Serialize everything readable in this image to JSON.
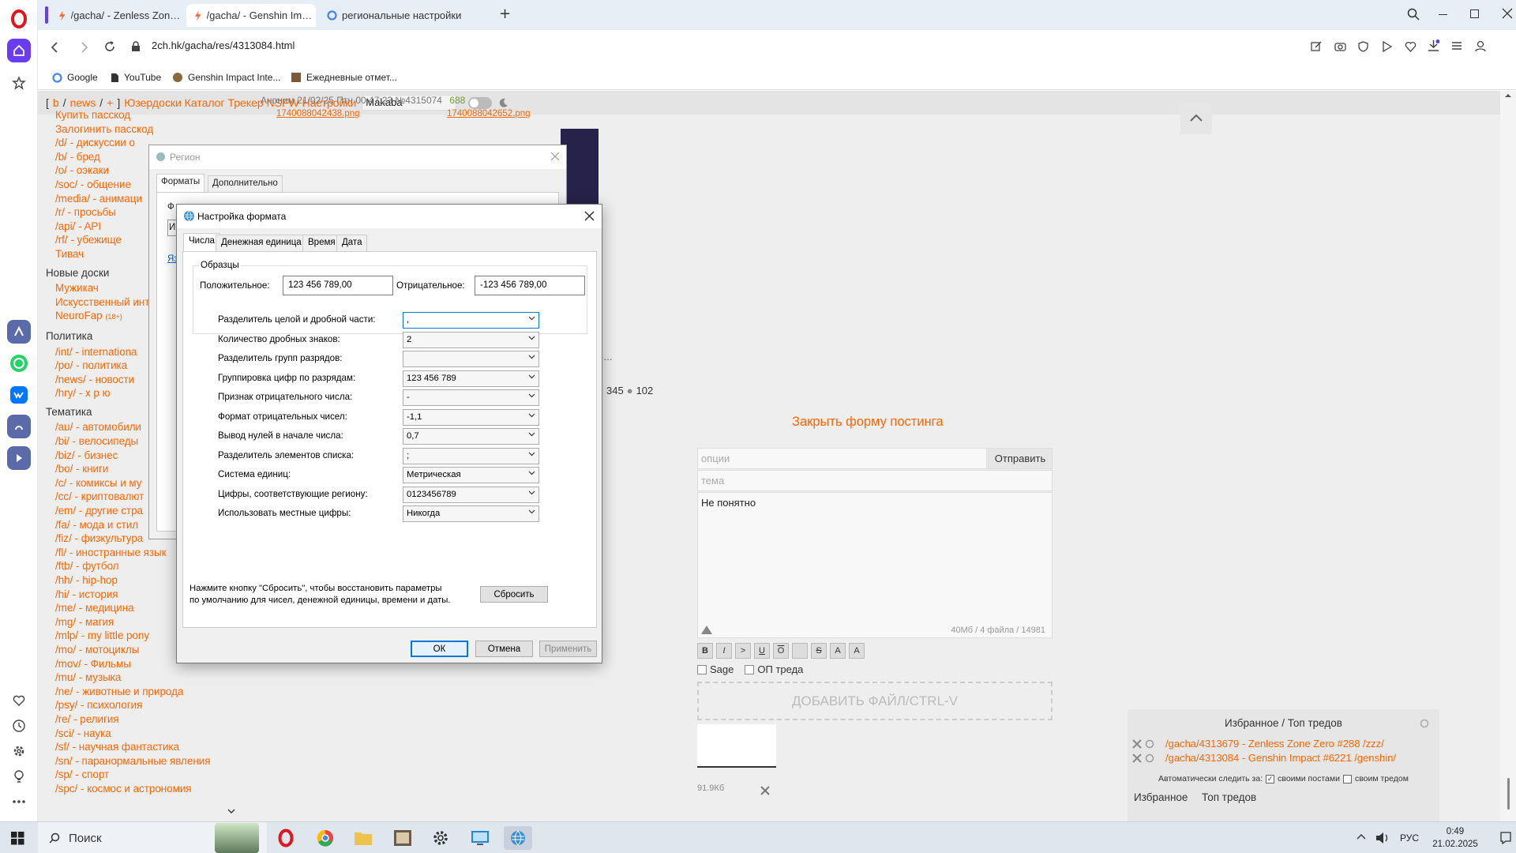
{
  "browser": {
    "tabs": [
      {
        "title": "/gacha/ - Zenless Zone Ze",
        "active": false
      },
      {
        "title": "/gacha/ - Genshin Impact",
        "active": true
      },
      {
        "title": "региональные настройки",
        "active": false
      }
    ],
    "new_tab": "+",
    "url": "2ch.hk/gacha/res/4313084.html",
    "bookmarks": [
      "Google",
      "YouTube",
      "Genshin Impact Inte...",
      "Ежедневные отмет..."
    ]
  },
  "site": {
    "nav": {
      "b": "b",
      "news": "news",
      "plus": "+",
      "rest": "Юзердоски Каталог Трекер NSFW Настройки",
      "style": "Makaba"
    },
    "boards_top": [
      "Купить пасскод",
      "Залогинить пасскод",
      "/d/ - дискуссии о",
      "/b/ - бред",
      "/o/ - оэкаки",
      "/soc/ - общение",
      "/media/ - анимаци",
      "/r/ - просьбы",
      "/api/ - API",
      "/rf/ - убежище",
      "Тивач"
    ],
    "new_boards_title": "Новые доски",
    "new_boards": [
      "Мужикач",
      "Искусственный инт",
      "NeuroFap"
    ],
    "neurofap_badge": "(18+)",
    "politics_title": "Политика",
    "politics": [
      "/int/ - internationa",
      "/po/ - политика",
      "/news/ - новости",
      "/hry/ - х р ю"
    ],
    "thematic_title": "Тематика",
    "thematic": [
      "/au/ - автомобили",
      "/bi/ - велосипеды",
      "/biz/ - бизнес",
      "/bo/ - книги",
      "/c/ - комиксы и му",
      "/cc/ - криптовалют",
      "/em/ - другие стра",
      "/fa/ - мода и стил",
      "/fiz/ - физкультура",
      "/fl/ - иностранные язык",
      "/ftb/ - футбол",
      "/hh/ - hip-hop",
      "/hi/ - история",
      "/me/ - медицина",
      "/mg/ - магия",
      "/mlp/ - my little pony",
      "/mo/ - мотоциклы",
      "/mov/ - Фильмы",
      "/mu/ - музыка",
      "/ne/ - животные и природа",
      "/psy/ - психология",
      "/re/ - религия",
      "/sci/ - наука",
      "/sf/ - научная фантастика",
      "/sn/ - паранормальные явления",
      "/sp/ - спорт",
      "/spc/ - космос и астрономия"
    ],
    "post_header": "Аноним 21/02/25 Птн 00:47:23 №4315074",
    "post_reply_count": "688",
    "file1": "1740088042438.png",
    "file2": "1740088042652.png",
    "post_ellipsis": "…",
    "stats": "345",
    "stats2": "102",
    "close_form": "Закрыть форму постинга",
    "options_placeholder": "опции",
    "send_button": "Отправить",
    "subject_placeholder": "тема",
    "comment": "Не понятно",
    "limits": "40Мб / 4 файла / 14981",
    "fmt_buttons": [
      "B",
      "I",
      ">",
      "U",
      "O",
      "",
      "S",
      "A",
      "A"
    ],
    "sage": "Sage",
    "op": "ОП треда",
    "add_file": "ДОБАВИТЬ ФАЙЛ/CTRL-V",
    "thumb_size": "91.9Кб",
    "favs_title": "Избранное / Топ тредов",
    "fav_threads": [
      "/gacha/4313679 - Zenless Zone Zero #288 /zzz/",
      "/gacha/4313084 - Genshin Impact #6221 /genshin/"
    ],
    "auto_watch": "Автоматически следить за:",
    "own_posts": "своими постами",
    "own_thread": "своим тредом",
    "fav_tabs": [
      "Избранное",
      "Топ тредов"
    ]
  },
  "region_dialog": {
    "title": "Регион",
    "tabs": [
      "Форматы",
      "Дополнительно"
    ],
    "frag_f": "Ф",
    "frag_i": "И",
    "frag_ya": "Яз"
  },
  "format_dialog": {
    "title": "Настройка формата",
    "tabs": [
      "Числа",
      "Денежная единица",
      "Время",
      "Дата"
    ],
    "samples_title": "Образцы",
    "positive_label": "Положительное:",
    "positive_value": "123 456 789,00",
    "negative_label": "Отрицательное:",
    "negative_value": "-123 456 789,00",
    "rows": [
      {
        "label": "Разделитель целой и дробной части:",
        "value": ","
      },
      {
        "label": "Количество дробных знаков:",
        "value": "2"
      },
      {
        "label": "Разделитель групп разрядов:",
        "value": ""
      },
      {
        "label": "Группировка цифр по разрядам:",
        "value": "123 456 789"
      },
      {
        "label": "Признак отрицательного числа:",
        "value": "-"
      },
      {
        "label": "Формат отрицательных чисел:",
        "value": "-1,1"
      },
      {
        "label": "Вывод нулей в начале числа:",
        "value": "0,7"
      },
      {
        "label": "Разделитель элементов списка:",
        "value": ";"
      },
      {
        "label": "Система единиц:",
        "value": "Метрическая"
      },
      {
        "label": "Цифры, соответствующие региону:",
        "value": "0123456789"
      },
      {
        "label": "Использовать местные цифры:",
        "value": "Никогда"
      }
    ],
    "reset_note_1": "Нажмите кнопку \"Сбросить\", чтобы восстановить параметры",
    "reset_note_2": "по умолчанию для чисел, денежной единицы, времени и даты.",
    "reset_button": "Сбросить",
    "ok_button": "ОК",
    "cancel_button": "Отмена",
    "apply_button": "Применить"
  },
  "taskbar": {
    "search_label": "Поиск",
    "lang": "РУС",
    "time": "0:49",
    "date": "21.02.2025"
  },
  "colors": {
    "accent": "#ff6600",
    "opera_red": "#e0161e",
    "win_blue": "#0078d7"
  }
}
